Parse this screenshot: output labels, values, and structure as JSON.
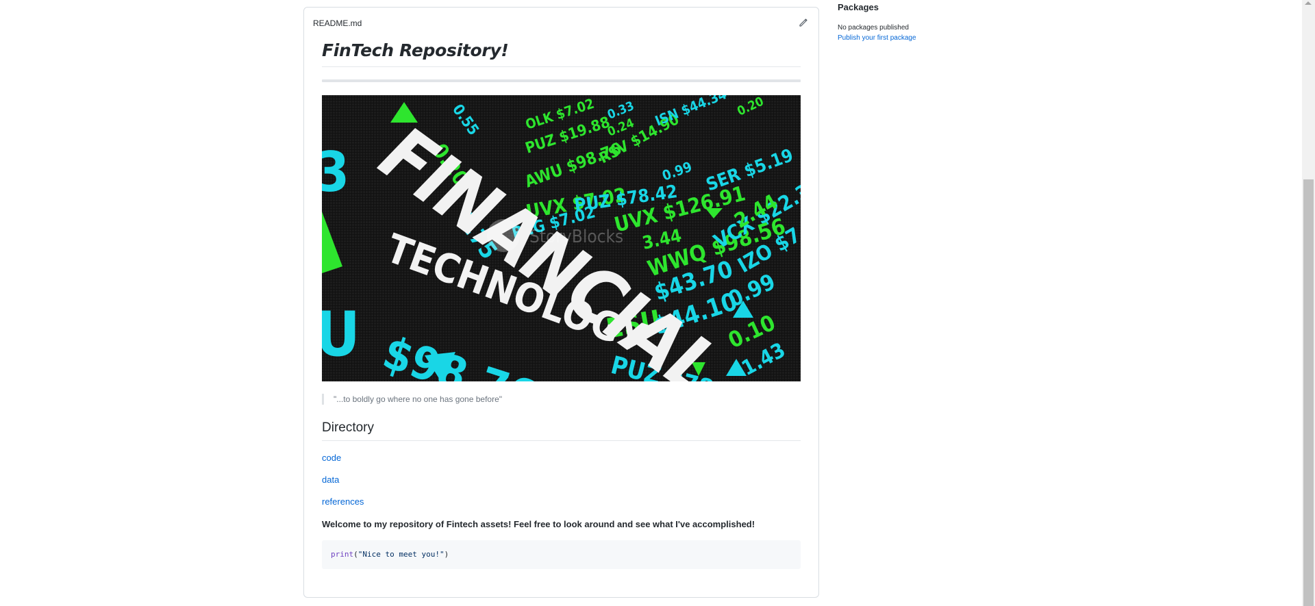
{
  "readme": {
    "filename": "README.md",
    "edit_icon": "pencil-icon",
    "title": "FinTech Repository!",
    "hero_image": {
      "headline_1": "FINANCIAL",
      "headline_2": "TECHNOLOGY",
      "watermark": "StoryBlocks",
      "tickers_cyan": [
        "$98.76",
        "$43.70",
        "$44.10",
        "0.75",
        "0.20",
        "REG $7.02",
        "PUZ $78.42",
        "SER $5.19",
        "IZO $7.0",
        "ISN $44.34",
        "0.33",
        "0.99",
        "1.43",
        "0.55"
      ],
      "tickers_green": [
        "ESU",
        "WWQ $98.56",
        "VCX $22.3",
        "UVX $126.91",
        "UVX $7.02",
        "AWU $98.76",
        "RSV $14.90",
        "VCX $14.90",
        "PUZ $19.88",
        "OLK $7.02",
        "2.44",
        "0.99",
        "0.10",
        "3.44",
        "0.24",
        "0.20"
      ],
      "colors": {
        "background": "#0e0e0e",
        "cyan": "#19d6e6",
        "green": "#2ee52e",
        "white": "#f2f2f2"
      }
    },
    "quote": "\"...to boldly go where no one has gone before\"",
    "directory_heading": "Directory",
    "links": [
      "code",
      "data",
      "references"
    ],
    "welcome": "Welcome to my repository of Fintech assets! Feel free to look around and see what I've accomplished!",
    "code": {
      "fn": "print",
      "open": "(",
      "str": "\"Nice to meet you!\"",
      "close": ")"
    }
  },
  "sidebar": {
    "packages_heading": "Packages",
    "no_packages": "No packages published",
    "publish_link": "Publish your first package"
  },
  "colors": {
    "link": "#0366d6",
    "text": "#24292e",
    "muted": "#6a737d",
    "border": "#d8dde2"
  }
}
